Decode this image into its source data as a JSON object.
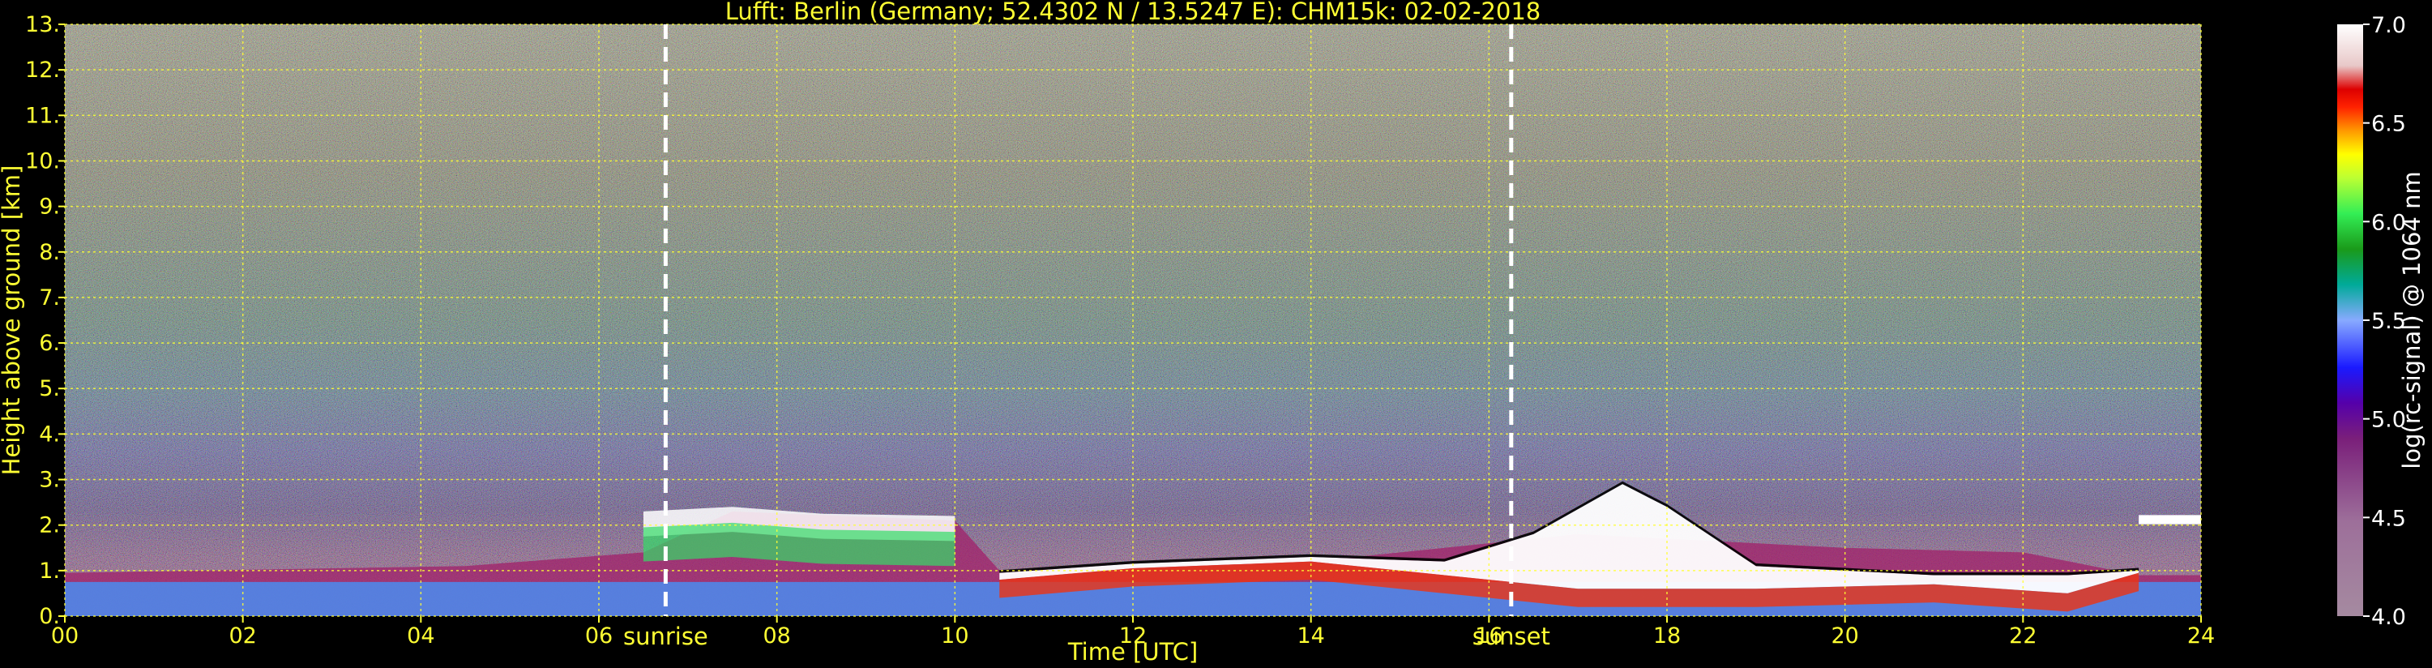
{
  "chart_data": {
    "type": "heatmap",
    "title": "Lufft: Berlin (Germany; 52.4302 N / 13.5247 E):    CHM15k: 02-02-2018",
    "xlabel": "Time [UTC]",
    "ylabel": "Height above ground [km]",
    "xlim": [
      0,
      24
    ],
    "ylim": [
      0,
      13
    ],
    "x_ticks": [
      "00",
      "02",
      "04",
      "06",
      "08",
      "10",
      "12",
      "14",
      "16",
      "18",
      "20",
      "22",
      "24"
    ],
    "y_ticks": [
      "0.",
      "1.",
      "2.",
      "3.",
      "4.",
      "5.",
      "6.",
      "7.",
      "8.",
      "9.",
      "10.",
      "11.",
      "12.",
      "13."
    ],
    "grid": true,
    "annotations": [
      {
        "text": "sunrise",
        "x": 6.75
      },
      {
        "text": "sunset",
        "x": 16.25
      }
    ],
    "colorbar": {
      "label": "log(rc-signal) @ 1064 nm",
      "range": [
        4.0,
        7.0
      ],
      "ticks": [
        "4.0",
        "4.5",
        "5.0",
        "5.5",
        "6.0",
        "6.5",
        "7.0"
      ]
    },
    "layers": {
      "aerosol_layer_top_km": [
        [
          0,
          0.95
        ],
        [
          4.5,
          1.1
        ],
        [
          6.5,
          1.4
        ],
        [
          7.5,
          2.3
        ],
        [
          10,
          2.1
        ],
        [
          10.5,
          1.0
        ],
        [
          14,
          1.2
        ],
        [
          17,
          1.8
        ],
        [
          20,
          1.5
        ],
        [
          22,
          1.4
        ],
        [
          23.3,
          0.9
        ],
        [
          24,
          0.9
        ]
      ],
      "cloud_base_km": [
        [
          10.5,
          0.8
        ],
        [
          12,
          1.05
        ],
        [
          14,
          1.2
        ],
        [
          15.5,
          0.9
        ],
        [
          17,
          0.6
        ],
        [
          19,
          0.6
        ],
        [
          21,
          0.7
        ],
        [
          22.5,
          0.5
        ],
        [
          23.3,
          0.95
        ]
      ],
      "cloud_top_km": [
        [
          10.5,
          0.95
        ],
        [
          12,
          1.15
        ],
        [
          14,
          1.3
        ],
        [
          15.5,
          1.2
        ],
        [
          16.5,
          1.8
        ],
        [
          17.5,
          2.9
        ],
        [
          18,
          2.4
        ],
        [
          19,
          1.1
        ],
        [
          21,
          0.9
        ],
        [
          22.5,
          0.9
        ],
        [
          23.3,
          1.0
        ]
      ],
      "residual_layer_top_km": [
        [
          6.5,
          2.3
        ],
        [
          7.5,
          2.4
        ],
        [
          8.5,
          2.25
        ],
        [
          10,
          2.2
        ]
      ],
      "isolated_cloud_km": [
        [
          23.3,
          2.1
        ],
        [
          24,
          2.1
        ]
      ]
    }
  }
}
